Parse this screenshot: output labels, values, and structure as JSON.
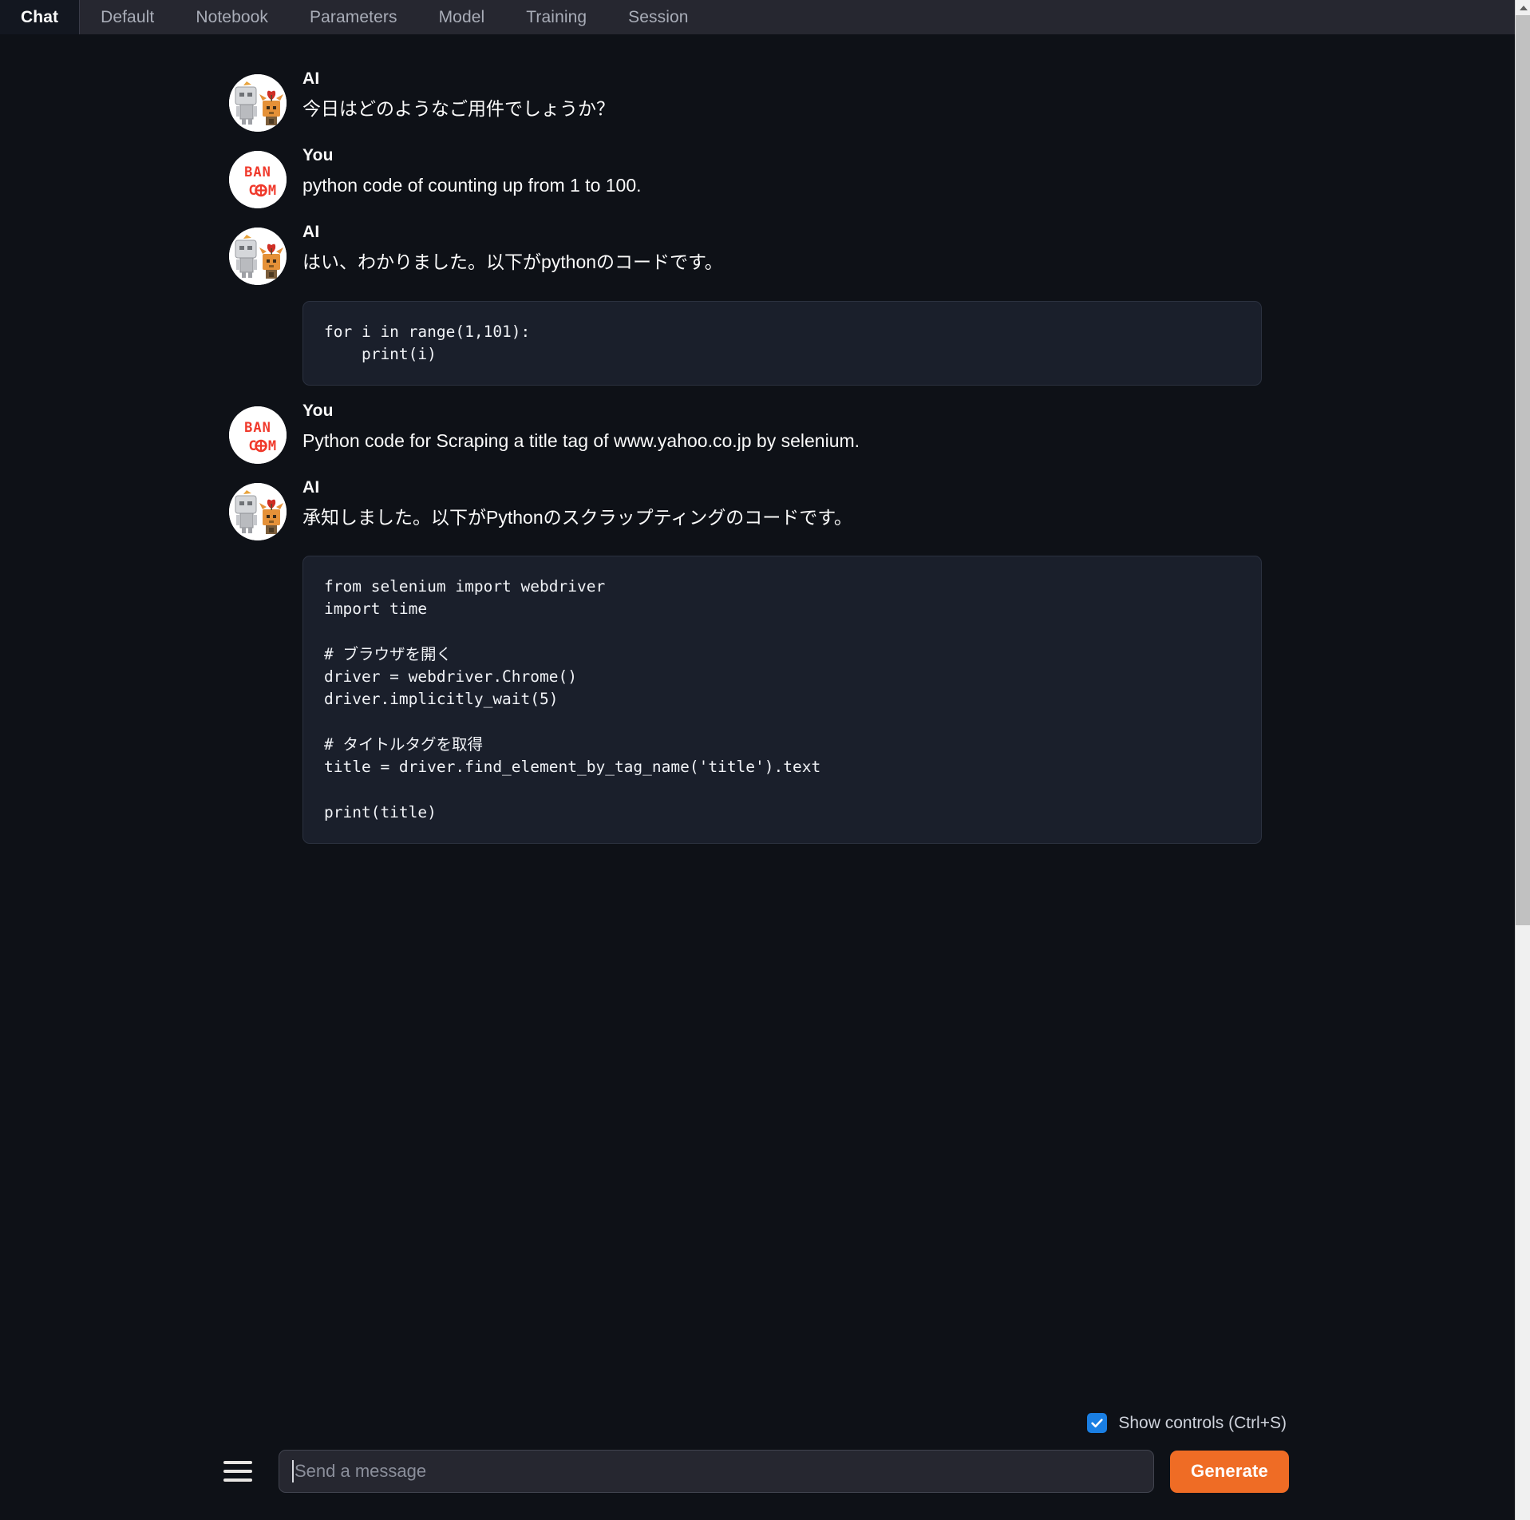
{
  "tabs": [
    {
      "label": "Chat",
      "active": true
    },
    {
      "label": "Default",
      "active": false
    },
    {
      "label": "Notebook",
      "active": false
    },
    {
      "label": "Parameters",
      "active": false
    },
    {
      "label": "Model",
      "active": false
    },
    {
      "label": "Training",
      "active": false
    },
    {
      "label": "Session",
      "active": false
    }
  ],
  "messages": [
    {
      "role": "AI",
      "avatar": "ai-robot-avatar",
      "text": "今日はどのようなご用件でしょうか？"
    },
    {
      "role": "You",
      "avatar": "user-bancom-avatar",
      "text": "python code of counting up from 1 to 100."
    },
    {
      "role": "AI",
      "avatar": "ai-robot-avatar",
      "text": "はい、わかりました。以下がpythonのコードです。",
      "code": "for i in range(1,101):\n    print(i)"
    },
    {
      "role": "You",
      "avatar": "user-bancom-avatar",
      "text": "Python code for Scraping a title tag of www.yahoo.co.jp by selenium."
    },
    {
      "role": "AI",
      "avatar": "ai-robot-avatar",
      "text": "承知しました。以下がPythonのスクラップティングのコードです。",
      "code": "from selenium import webdriver\nimport time\n\n# ブラウザを開く\ndriver = webdriver.Chrome()\ndriver.implicitly_wait(5)\n\n# タイトルタグを取得\ntitle = driver.find_element_by_tag_name('title').text\n\nprint(title)"
    }
  ],
  "controls": {
    "show_controls_label": "Show controls (Ctrl+S)",
    "show_controls_checked": true,
    "menu_icon": "hamburger-menu-icon",
    "input_placeholder": "Send a message",
    "input_value": "",
    "generate_label": "Generate"
  },
  "colors": {
    "background": "#0e1117",
    "tabbar": "#262730",
    "active_tab": "#131720",
    "code_block": "#1a1f2b",
    "accent_orange": "#ef6c25",
    "checkbox_blue": "#1a7fe3",
    "avatar_red": "#f0392b"
  },
  "avatar_text": {
    "line1": "BAN",
    "line2": "COM"
  }
}
